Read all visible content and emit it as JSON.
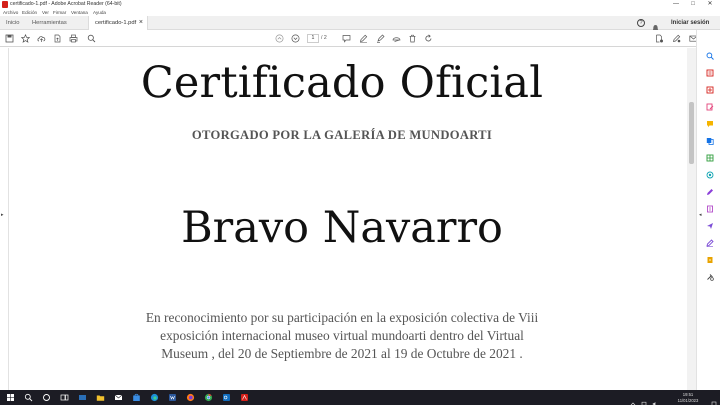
{
  "window": {
    "title": "certificado-1.pdf - Adobe Acrobat Reader (64-bit)",
    "controls": {
      "minimize": "—",
      "maximize": "□",
      "close": "✕"
    }
  },
  "menu": [
    "Archivo",
    "Edición",
    "Ver",
    "Firmar",
    "Ventana",
    "Ayuda"
  ],
  "tabs": {
    "home": "Inicio",
    "tools": "Herramientas",
    "document": "certificado-1.pdf",
    "close": "×"
  },
  "account": {
    "sign_in": "Iniciar sesión",
    "help": "?"
  },
  "toolbar": {
    "current_page": "1",
    "total_pages": "/ 2"
  },
  "document": {
    "title": "Certificado Oficial",
    "subtitle": "OTORGADO POR LA GALERÍA DE MUNDOARTI",
    "recipient": "Bravo Navarro",
    "body": "En reconocimiento por su participación en la exposición colectiva de Viii exposición internacional museo virtual mundoarti dentro del Virtual Museum , del 20 de Septiembre de 2021 al 19 de Octubre de 2021 ."
  },
  "taskbar": {
    "time": "19:51",
    "date": "11/01/2023"
  },
  "colors": {
    "acrobat_red": "#d4201a",
    "taskbar": "#1c1c24",
    "accent_blue": "#1473e6"
  }
}
